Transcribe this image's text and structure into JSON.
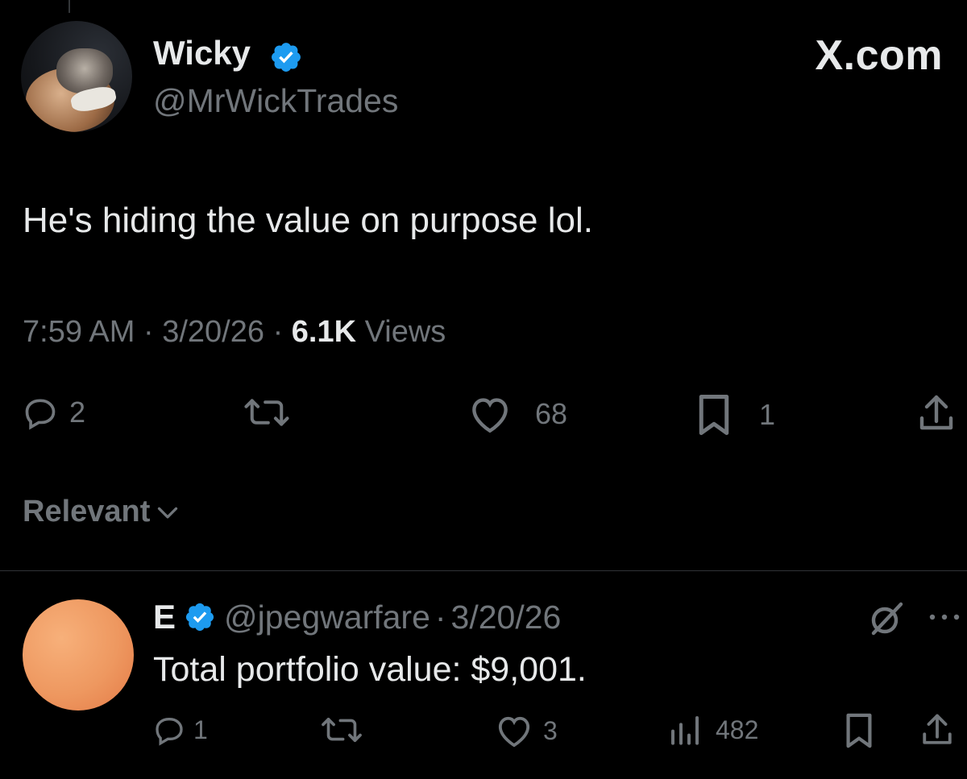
{
  "brand": {
    "label": "X.com"
  },
  "tweet": {
    "author_name": "Wicky",
    "author_handle": "@MrWickTrades",
    "text": "He's hiding the value on purpose lol.",
    "time": "7:59 AM",
    "separator": "·",
    "date": "3/20/26",
    "views_count": "6.1K",
    "views_label": "Views",
    "actions": {
      "replies": "2",
      "likes": "68",
      "bookmarks": "1"
    }
  },
  "sort": {
    "label": "Relevant"
  },
  "reply": {
    "author_name": "E",
    "author_handle": "@jpegwarfare",
    "separator": "·",
    "date": "3/20/26",
    "text": "Total portfolio value: $9,001.",
    "actions": {
      "replies": "1",
      "likes": "3",
      "views": "482"
    }
  },
  "colors": {
    "background": "#000000",
    "text_primary": "#e7e9ea",
    "text_secondary": "#71767b",
    "verified": "#1d9bf0",
    "reply_avatar": "#ee9860"
  },
  "icons": [
    "verified-badge-icon",
    "reply-icon",
    "retweet-icon",
    "like-icon",
    "bookmark-icon",
    "share-icon",
    "chevron-down-icon",
    "analytics-icon",
    "grok-icon",
    "more-icon"
  ]
}
